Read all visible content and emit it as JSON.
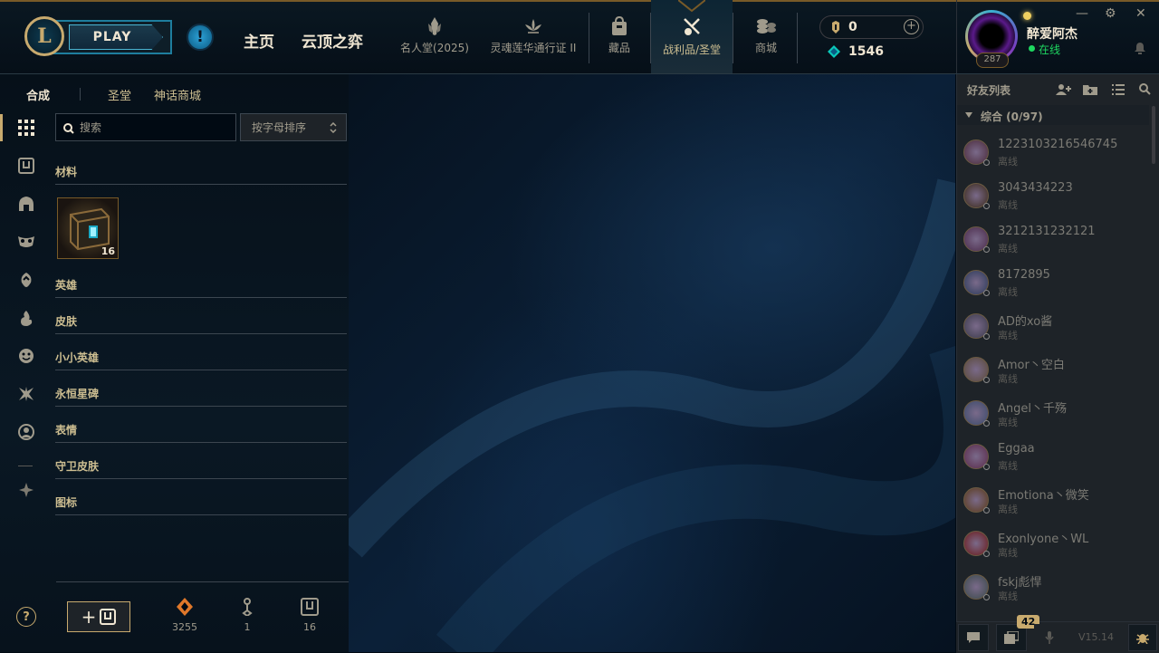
{
  "colors": {
    "gold": "#c8aa6e",
    "blue": "#0ac8b9",
    "online": "#1ed760",
    "offline": "#5b5a56"
  },
  "topbar": {
    "logo": "L",
    "play_label": "PLAY",
    "alert": "!",
    "nav_main": [
      "主页",
      "云顶之弈"
    ],
    "nav_icons": [
      {
        "label": "名人堂(2025)",
        "icon": "hall-of-legends-icon"
      },
      {
        "label": "灵魂莲华通行证 II",
        "icon": "lotus-pass-icon"
      },
      {
        "label": "藏品",
        "icon": "collection-bag-icon"
      },
      {
        "label": "战利品/圣堂",
        "icon": "loot-icon"
      },
      {
        "label": "商城",
        "icon": "store-coins-icon"
      }
    ],
    "currency": {
      "rp": "0",
      "be": "1546",
      "plus": "+"
    }
  },
  "profile": {
    "name": "醉爱阿杰",
    "status": "在线",
    "level": "287"
  },
  "window": {
    "minimize": "—",
    "settings": "⚙",
    "close": "✕"
  },
  "loot": {
    "tabs": [
      "合成",
      "圣堂",
      "神话商城"
    ],
    "search_placeholder": "搜索",
    "sort_label": "按字母排序",
    "categories": [
      "材料",
      "英雄",
      "皮肤",
      "小小英雄",
      "永恒星碑",
      "表情",
      "守卫皮肤",
      "图标"
    ],
    "material_count": "16",
    "essences": [
      {
        "icon": "orange-essence-icon",
        "value": "3255"
      },
      {
        "icon": "key-icon",
        "value": "1"
      },
      {
        "icon": "chest-icon",
        "value": "16"
      }
    ],
    "help": "?"
  },
  "friends": {
    "title": "好友列表",
    "group_label": "综合 (0/97)",
    "list": [
      {
        "name": "1223103216546745",
        "status": "离线",
        "color": "#4a2a3a"
      },
      {
        "name": "3043434223",
        "status": "离线",
        "color": "#3a2a1a"
      },
      {
        "name": "3212131232121",
        "status": "离线",
        "color": "#4a2a4a"
      },
      {
        "name": "8172895",
        "status": "离线",
        "color": "#2a3a5a"
      },
      {
        "name": "AD的xo酱",
        "status": "离线",
        "color": "#3a3a4a"
      },
      {
        "name": "Amor丶空白",
        "status": "离线",
        "color": "#5a4a3a"
      },
      {
        "name": "Angel丶千殇",
        "status": "离线",
        "color": "#3a4a6a"
      },
      {
        "name": "Eggaa",
        "status": "离线",
        "color": "#5a2a4a"
      },
      {
        "name": "Emotiona丶微笑",
        "status": "离线",
        "color": "#5a3a1a"
      },
      {
        "name": "Exonlyone丶WL",
        "status": "离线",
        "color": "#6a1a1a"
      },
      {
        "name": "fskj彪悍",
        "status": "离线",
        "color": "#3a4a4a"
      }
    ],
    "notification_count": "42",
    "version": "V15.14"
  }
}
